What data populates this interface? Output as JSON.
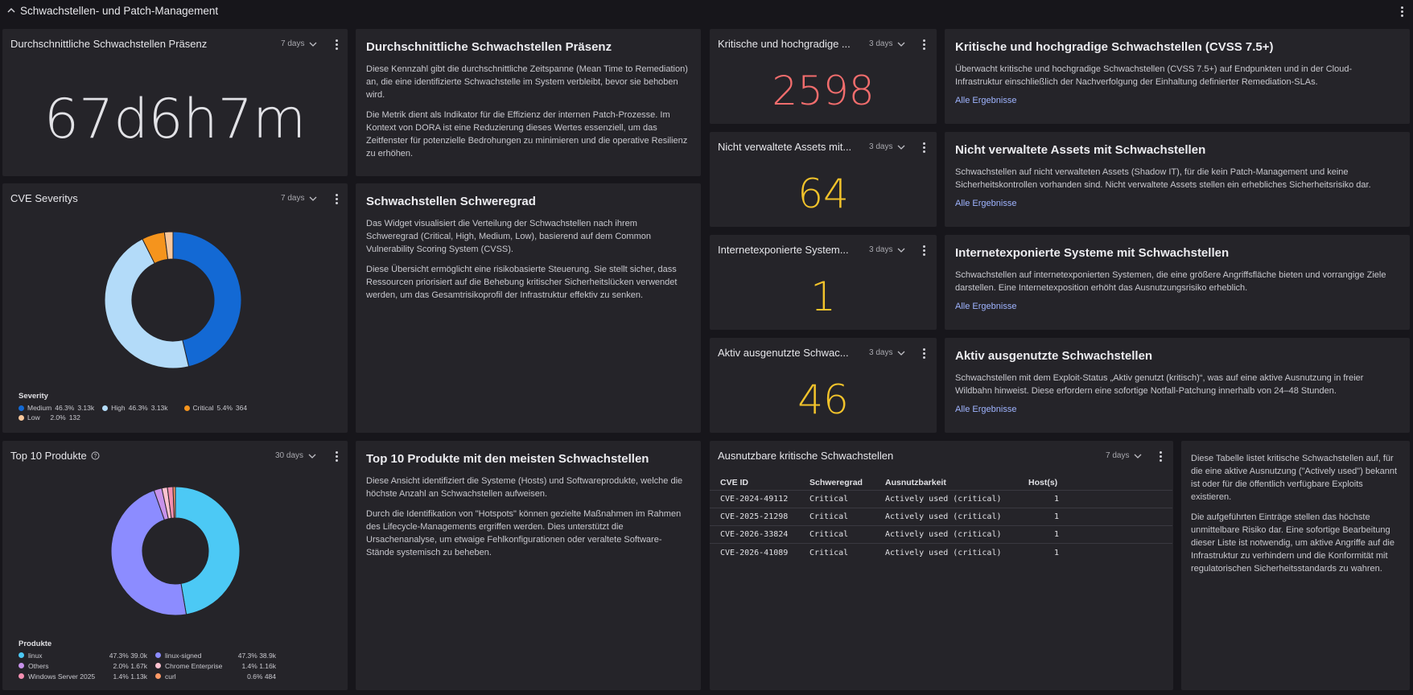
{
  "section": {
    "title": "Schwachstellen- und Patch-Management"
  },
  "mttr_metric": {
    "title": "Durchschnittliche Schwachstellen Präsenz",
    "range": "7 days",
    "value": "67d6h7m"
  },
  "mttr_desc": {
    "title": "Durchschnittliche Schwachstellen Präsenz",
    "p1": "Diese Kennzahl gibt die durchschnittliche Zeitspanne (Mean Time to Remediation) an, die eine identifizierte Schwachstelle im System verbleibt, bevor sie behoben wird.",
    "p2": "Die Metrik dient als Indikator für die Effizienz der internen Patch-Prozesse. Im Kontext von DORA ist eine Reduzierung dieses Wertes essenziell, um das Zeitfenster für potenzielle Bedrohungen zu minimieren und die operative Resilienz zu erhöhen."
  },
  "severity_chart": {
    "title": "CVE Severitys",
    "range": "7 days",
    "legend_title": "Severity",
    "legend": [
      {
        "label": "Medium",
        "pct": "46.3%",
        "count": "3.13k"
      },
      {
        "label": "High",
        "pct": "46.3%",
        "count": "3.13k"
      },
      {
        "label": "Critical",
        "pct": "5.4%",
        "count": "364"
      },
      {
        "label": "Low",
        "pct": "2.0%",
        "count": "132"
      }
    ]
  },
  "severity_desc": {
    "title": "Schwachstellen Schweregrad",
    "p1": "Das Widget visualisiert die Verteilung der Schwachstellen nach ihrem Schweregrad (Critical, High, Medium, Low), basierend auf dem Common Vulnerability Scoring System (CVSS).",
    "p2": "Diese Übersicht ermöglicht eine risikobasierte Steuerung. Sie stellt sicher, dass Ressourcen priorisiert auf die Behebung kritischer Sicherheitslücken verwendet werden, um das Gesamtrisikoprofil der Infrastruktur effektiv zu senken."
  },
  "products_chart": {
    "title": "Top 10 Produkte",
    "range": "30 days",
    "legend_title": "Produkte",
    "legend": [
      {
        "label": "linux",
        "pct": "47.3%",
        "count": "39.0k"
      },
      {
        "label": "linux-signed",
        "pct": "47.3%",
        "count": "38.9k"
      },
      {
        "label": "Others",
        "pct": "2.0%",
        "count": "1.67k"
      },
      {
        "label": "Chrome Enterprise",
        "pct": "1.4%",
        "count": "1.16k"
      },
      {
        "label": "Windows Server 2025",
        "pct": "1.4%",
        "count": "1.13k"
      },
      {
        "label": "curl",
        "pct": "0.6%",
        "count": "484"
      }
    ]
  },
  "products_desc": {
    "title": "Top 10 Produkte mit den meisten Schwachstellen",
    "p1": "Diese Ansicht identifiziert die Systeme (Hosts) und Softwareprodukte, welche die höchste Anzahl an Schwachstellen aufweisen.",
    "p2": "Durch die Identifikation von \"Hotspots\" können gezielte Maßnahmen im Rahmen des Lifecycle-Managements ergriffen werden. Dies unterstützt die Ursachenanalyse, um etwaige Fehlkonfigurationen oder veraltete Software-Stände systemisch zu beheben."
  },
  "kpis": [
    {
      "title": "Kritische und hochgradige ...",
      "range": "3 days",
      "value": "2598",
      "color": "#f26d6d"
    },
    {
      "title": "Nicht verwaltete Assets mit...",
      "range": "3 days",
      "value": "64",
      "color": "#f2c32b"
    },
    {
      "title": "Internetexponierte System...",
      "range": "3 days",
      "value": "1",
      "color": "#f2c32b"
    },
    {
      "title": "Aktiv ausgenutzte Schwac...",
      "range": "3 days",
      "value": "46",
      "color": "#f2c32b"
    }
  ],
  "kpi_descs": [
    {
      "title": "Kritische und hochgradige Schwachstellen (CVSS 7.5+)",
      "text": "Überwacht kritische und hochgradige Schwachstellen (CVSS 7.5+) auf Endpunkten und in der Cloud-Infrastruktur einschließlich der Nachverfolgung der Einhaltung definierter Remediation-SLAs.",
      "link": "Alle Ergebnisse"
    },
    {
      "title": "Nicht verwaltete Assets mit Schwachstellen",
      "text": "Schwachstellen auf nicht verwalteten Assets (Shadow IT), für die kein Patch-Management und keine Sicherheitskontrollen vorhanden sind. Nicht verwaltete Assets stellen ein erhebliches Sicherheitsrisiko dar.",
      "link": "Alle Ergebnisse"
    },
    {
      "title": "Internetexponierte Systeme mit Schwachstellen",
      "text": "Schwachstellen auf internetexponierten Systemen, die eine größere Angriffsfläche bieten und vorrangige Ziele darstellen. Eine Internetexposition erhöht das Ausnutzungsrisiko erheblich.",
      "link": "Alle Ergebnisse"
    },
    {
      "title": "Aktiv ausgenutzte Schwachstellen",
      "text": "Schwachstellen mit dem Exploit-Status „Aktiv genutzt (kritisch)“, was auf eine aktive Ausnutzung in freier Wildbahn hinweist. Diese erfordern eine sofortige Notfall-Patchung innerhalb von 24–48 Stunden.",
      "link": "Alle Ergebnisse"
    }
  ],
  "exploit_table": {
    "title": "Ausnutzbare kritische Schwachstellen",
    "range": "7 days",
    "columns": [
      "CVE ID",
      "Schweregrad",
      "Ausnutzbarkeit",
      "Host(s)"
    ],
    "rows": [
      [
        "CVE-2024-49112",
        "Critical",
        "Actively used (critical)",
        "1"
      ],
      [
        "CVE-2025-21298",
        "Critical",
        "Actively used (critical)",
        "1"
      ],
      [
        "CVE-2026-33824",
        "Critical",
        "Actively used (critical)",
        "1"
      ],
      [
        "CVE-2026-41089",
        "Critical",
        "Actively used (critical)",
        "1"
      ]
    ]
  },
  "exploit_desc": {
    "p1": "Diese Tabelle listet kritische Schwachstellen auf, für die eine aktive Ausnutzung (\"Actively used\") bekannt ist oder für die öffentlich verfügbare Exploits existieren.",
    "p2": "Die aufgeführten Einträge stellen das höchste unmittelbare Risiko dar. Eine sofortige Bearbeitung dieser Liste ist notwendig, um aktive Angriffe auf die Infrastruktur zu verhindern und die Konformität mit regulatorischen Sicherheitsstandards zu wahren."
  },
  "chart_data": [
    {
      "type": "pie",
      "categories": [
        "Medium",
        "High",
        "Critical",
        "Low"
      ],
      "values": [
        46.3,
        46.3,
        5.4,
        2.0
      ],
      "colors": [
        "#1369d4",
        "#b3dbf9",
        "#f5941d",
        "#f9c79b"
      ],
      "legend": "bottom-left"
    },
    {
      "type": "pie",
      "categories": [
        "linux",
        "linux-signed",
        "Others",
        "Chrome Enterprise",
        "Windows Server 2025",
        "curl"
      ],
      "values": [
        47.3,
        47.3,
        2.0,
        1.4,
        1.4,
        0.6
      ],
      "colors": [
        "#4cc9f5",
        "#8c8cff",
        "#c792ea",
        "#ffc2d0",
        "#f48fb1",
        "#ff9966"
      ],
      "legend": "bottom-left"
    }
  ]
}
